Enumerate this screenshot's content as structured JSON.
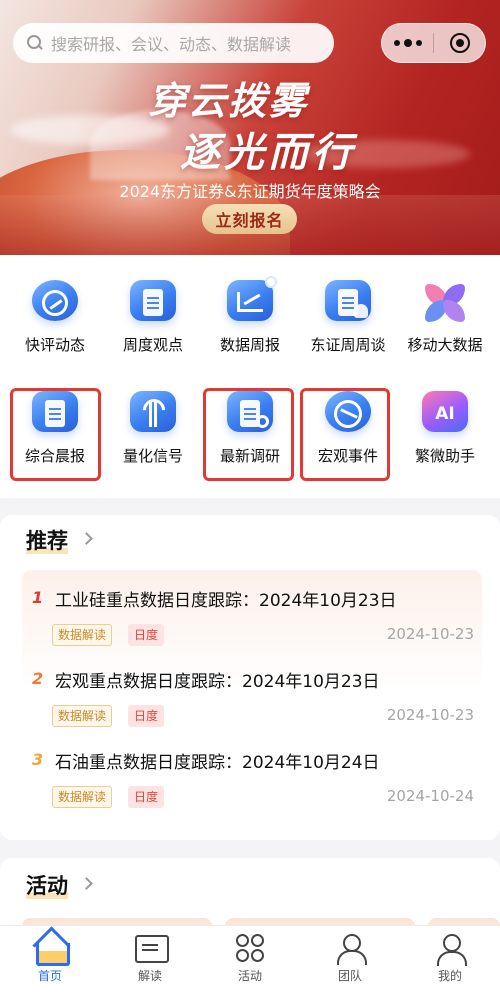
{
  "search": {
    "placeholder": "搜索研报、会议、动态、数据解读"
  },
  "banner": {
    "slogan_line1": "穿云拨雾",
    "slogan_line2": "逐光而行",
    "event_title": "2024东方证券&东证期货年度策略会",
    "register_label": "立刻报名"
  },
  "grid": {
    "row1": [
      {
        "label": "快评动态",
        "icon": "flash-comment-icon"
      },
      {
        "label": "周度观点",
        "icon": "document-icon"
      },
      {
        "label": "数据周报",
        "icon": "chart-icon"
      },
      {
        "label": "东证周周谈",
        "icon": "talk-icon"
      },
      {
        "label": "移动大数据",
        "icon": "star-logo-icon"
      }
    ],
    "row2": [
      {
        "label": "综合晨报",
        "icon": "document-icon"
      },
      {
        "label": "量化信号",
        "icon": "signal-icon"
      },
      {
        "label": "最新调研",
        "icon": "research-icon"
      },
      {
        "label": "宏观事件",
        "icon": "globe-icon"
      },
      {
        "label": "繁微助手",
        "icon": "ai-icon",
        "icon_text": "AI"
      }
    ]
  },
  "recommend": {
    "title": "推荐",
    "items": [
      {
        "num": "1",
        "title": "工业硅重点数据日度跟踪：2024年10月23日",
        "tag1": "数据解读",
        "tag2": "日度",
        "date": "2024-10-23"
      },
      {
        "num": "2",
        "title": "宏观重点数据日度跟踪：2024年10月23日",
        "tag1": "数据解读",
        "tag2": "日度",
        "date": "2024-10-23"
      },
      {
        "num": "3",
        "title": "石油重点数据日度跟踪：2024年10月24日",
        "tag1": "数据解读",
        "tag2": "日度",
        "date": "2024-10-24"
      }
    ]
  },
  "activity": {
    "title": "活动"
  },
  "tabbar": [
    {
      "label": "首页",
      "icon": "home-icon",
      "active": true
    },
    {
      "label": "解读",
      "icon": "read-icon"
    },
    {
      "label": "活动",
      "icon": "activity-icon"
    },
    {
      "label": "团队",
      "icon": "team-icon"
    },
    {
      "label": "我的",
      "icon": "profile-icon"
    }
  ],
  "colors": {
    "accent": "#2c6cf0",
    "highlight_border": "#e23a32",
    "banner_red": "#b32421"
  }
}
